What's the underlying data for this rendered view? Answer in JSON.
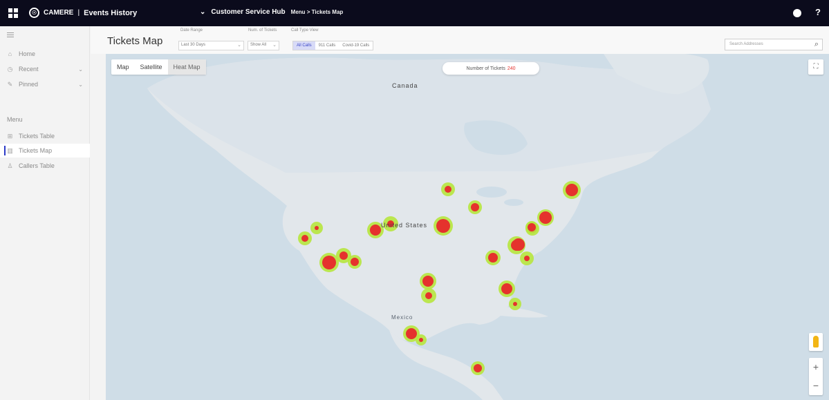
{
  "topbar": {
    "brand_logo": "☉",
    "brand_name": "CAMERE",
    "brand_separator": "|",
    "app_name": "Events History",
    "hub_name": "Customer Service Hub",
    "breadcrumb": "Menu > Tickets Map",
    "help_label": "?"
  },
  "sidebar": {
    "items": [
      {
        "label": "Home",
        "icon": "home-icon"
      },
      {
        "label": "Recent",
        "icon": "clock-icon"
      },
      {
        "label": "Pinned",
        "icon": "pin-icon"
      }
    ],
    "menu_heading": "Menu",
    "menu_items": [
      {
        "label": "Tickets Table",
        "icon": "table-icon"
      },
      {
        "label": "Tickets Map",
        "icon": "map-icon",
        "active": true
      },
      {
        "label": "Callers Table",
        "icon": "person-icon"
      }
    ]
  },
  "header": {
    "title": "Tickets Map",
    "date_range_label": "Date Range",
    "date_range_value": "Last 30 Days",
    "tickets_label": "Num. of Tickets",
    "tickets_value": "Show All",
    "call_type_label": "Call Type View",
    "call_type_options": [
      "All Calls",
      "911 Calls",
      "Covid-19 Calls"
    ],
    "search_placeholder": "Search Addresses"
  },
  "map": {
    "tabs": [
      "Map",
      "Satellite",
      "Heat Map"
    ],
    "selected_tab": "Heat Map",
    "tickets_count_label": "Number of Tickets",
    "tickets_count_value": "240",
    "labels": {
      "canada": "Canada",
      "united_states": "United States",
      "mexico": "Mexico"
    },
    "colors": {
      "ocean": "#cfdde7",
      "land": "#dfe5ea",
      "hot": "#e5322d",
      "warm": "#b7e63e"
    }
  }
}
